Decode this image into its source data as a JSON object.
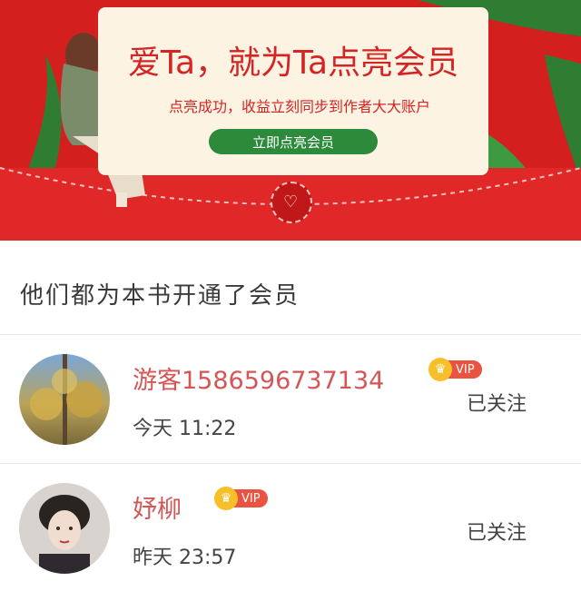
{
  "banner": {
    "title": "爱Ta，就为Ta点亮会员",
    "subtitle": "点亮成功，收益立刻同步到作者大大账户",
    "cta_label": "立即点亮会员",
    "colors": {
      "background": "#d41f1f",
      "letter": "#fdf3e3",
      "cta": "#2d8a3a"
    }
  },
  "section": {
    "title": "他们都为本书开通了会员"
  },
  "members": [
    {
      "name": "游客1586596737134",
      "badge": "VIP",
      "time": "今天 11:22",
      "follow_label": "已关注"
    },
    {
      "name": "妤柳",
      "badge": "VIP",
      "time": "昨天 23:57",
      "follow_label": "已关注"
    }
  ],
  "colors": {
    "name": "#d45656",
    "vip": "#e9533f",
    "crown": "#f7c02a"
  }
}
